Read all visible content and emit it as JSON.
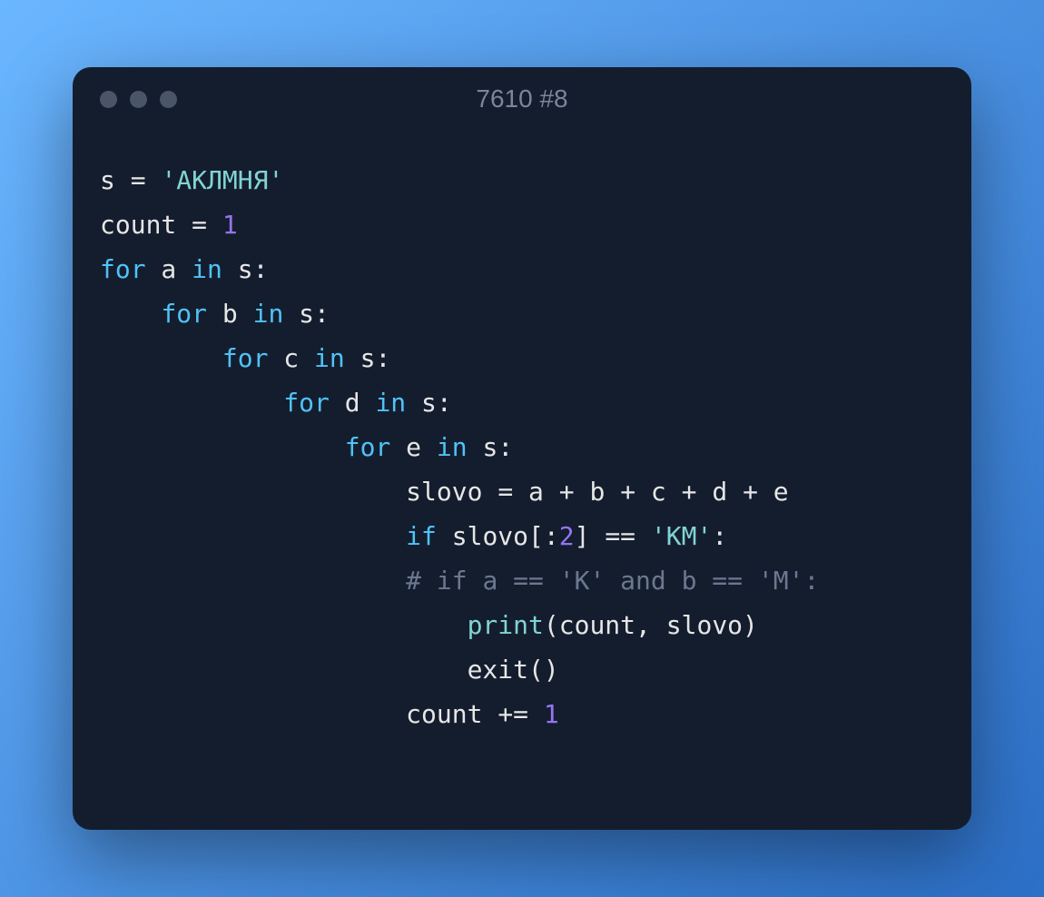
{
  "window": {
    "title": "7610 #8"
  },
  "code": {
    "lines": [
      {
        "indent": 0,
        "tokens": [
          {
            "text": "s ",
            "cls": "t-default"
          },
          {
            "text": "=",
            "cls": "t-operator"
          },
          {
            "text": " ",
            "cls": "t-default"
          },
          {
            "text": "'АКЛМНЯ'",
            "cls": "t-string"
          }
        ]
      },
      {
        "indent": 0,
        "tokens": [
          {
            "text": "count ",
            "cls": "t-default"
          },
          {
            "text": "=",
            "cls": "t-operator"
          },
          {
            "text": " ",
            "cls": "t-default"
          },
          {
            "text": "1",
            "cls": "t-number"
          }
        ]
      },
      {
        "indent": 0,
        "tokens": [
          {
            "text": "for",
            "cls": "t-keyword"
          },
          {
            "text": " a ",
            "cls": "t-default"
          },
          {
            "text": "in",
            "cls": "t-keyword"
          },
          {
            "text": " s",
            "cls": "t-default"
          },
          {
            "text": ":",
            "cls": "t-punct"
          }
        ]
      },
      {
        "indent": 1,
        "tokens": [
          {
            "text": "for",
            "cls": "t-keyword"
          },
          {
            "text": " b ",
            "cls": "t-default"
          },
          {
            "text": "in",
            "cls": "t-keyword"
          },
          {
            "text": " s",
            "cls": "t-default"
          },
          {
            "text": ":",
            "cls": "t-punct"
          }
        ]
      },
      {
        "indent": 2,
        "tokens": [
          {
            "text": "for",
            "cls": "t-keyword"
          },
          {
            "text": " c ",
            "cls": "t-default"
          },
          {
            "text": "in",
            "cls": "t-keyword"
          },
          {
            "text": " s",
            "cls": "t-default"
          },
          {
            "text": ":",
            "cls": "t-punct"
          }
        ]
      },
      {
        "indent": 3,
        "tokens": [
          {
            "text": "for",
            "cls": "t-keyword"
          },
          {
            "text": " d ",
            "cls": "t-default"
          },
          {
            "text": "in",
            "cls": "t-keyword"
          },
          {
            "text": " s",
            "cls": "t-default"
          },
          {
            "text": ":",
            "cls": "t-punct"
          }
        ]
      },
      {
        "indent": 4,
        "tokens": [
          {
            "text": "for",
            "cls": "t-keyword"
          },
          {
            "text": " e ",
            "cls": "t-default"
          },
          {
            "text": "in",
            "cls": "t-keyword"
          },
          {
            "text": " s",
            "cls": "t-default"
          },
          {
            "text": ":",
            "cls": "t-punct"
          }
        ]
      },
      {
        "indent": 5,
        "tokens": [
          {
            "text": "slovo ",
            "cls": "t-default"
          },
          {
            "text": "=",
            "cls": "t-operator"
          },
          {
            "text": " a ",
            "cls": "t-default"
          },
          {
            "text": "+",
            "cls": "t-operator"
          },
          {
            "text": " b ",
            "cls": "t-default"
          },
          {
            "text": "+",
            "cls": "t-operator"
          },
          {
            "text": " c ",
            "cls": "t-default"
          },
          {
            "text": "+",
            "cls": "t-operator"
          },
          {
            "text": " d ",
            "cls": "t-default"
          },
          {
            "text": "+",
            "cls": "t-operator"
          },
          {
            "text": " e",
            "cls": "t-default"
          }
        ]
      },
      {
        "indent": 5,
        "tokens": [
          {
            "text": "if",
            "cls": "t-keyword"
          },
          {
            "text": " slovo",
            "cls": "t-default"
          },
          {
            "text": "[:",
            "cls": "t-punct"
          },
          {
            "text": "2",
            "cls": "t-number"
          },
          {
            "text": "]",
            "cls": "t-punct"
          },
          {
            "text": " ",
            "cls": "t-default"
          },
          {
            "text": "==",
            "cls": "t-operator"
          },
          {
            "text": " ",
            "cls": "t-default"
          },
          {
            "text": "'КМ'",
            "cls": "t-string"
          },
          {
            "text": ":",
            "cls": "t-punct"
          }
        ]
      },
      {
        "indent": 5,
        "tokens": [
          {
            "text": "# if a == 'К' and b == 'М':",
            "cls": "t-comment"
          }
        ]
      },
      {
        "indent": 6,
        "tokens": [
          {
            "text": "print",
            "cls": "t-builtin"
          },
          {
            "text": "(",
            "cls": "t-punct"
          },
          {
            "text": "count",
            "cls": "t-default"
          },
          {
            "text": ",",
            "cls": "t-punct"
          },
          {
            "text": " slovo",
            "cls": "t-default"
          },
          {
            "text": ")",
            "cls": "t-punct"
          }
        ]
      },
      {
        "indent": 6,
        "tokens": [
          {
            "text": "exit",
            "cls": "t-default"
          },
          {
            "text": "()",
            "cls": "t-punct"
          }
        ]
      },
      {
        "indent": 5,
        "tokens": [
          {
            "text": "count ",
            "cls": "t-default"
          },
          {
            "text": "+=",
            "cls": "t-operator"
          },
          {
            "text": " ",
            "cls": "t-default"
          },
          {
            "text": "1",
            "cls": "t-number"
          }
        ]
      }
    ],
    "indent_unit": "    "
  }
}
